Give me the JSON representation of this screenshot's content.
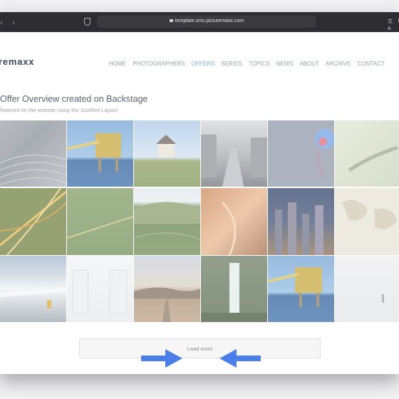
{
  "browser": {
    "back_glyph": "‹",
    "forward_glyph": "›",
    "url": "template.cms.picturemaxx.com",
    "translate_glyph": "文A",
    "reload_glyph": "↻"
  },
  "site": {
    "logo": "remaxx",
    "nav": [
      "HOME",
      "PHOTOGRAPHERS",
      "OFFERS",
      "SERIES",
      "TOPICS",
      "NEWS",
      "ABOUT",
      "ARCHIVE",
      "CONTACT"
    ],
    "active_nav": "OFFERS"
  },
  "page": {
    "title": "Offer Overview created on Backstage",
    "subtitle_prefix": "featured on the website using the ",
    "subtitle_emphasis": "Justified Layout"
  },
  "gallery": {
    "images": [
      {
        "subject": "abstract-lines"
      },
      {
        "subject": "oil-platform"
      },
      {
        "subject": "farmhouse-field"
      },
      {
        "subject": "city-street"
      },
      {
        "subject": "jellyfish"
      },
      {
        "subject": "crocodile"
      },
      {
        "subject": "light-trails"
      },
      {
        "subject": "green-field-line"
      },
      {
        "subject": "green-hills"
      },
      {
        "subject": "orange-abstract"
      },
      {
        "subject": "city-night-skyline"
      },
      {
        "subject": "world-map"
      },
      {
        "subject": "icy-waterfall-hiker"
      },
      {
        "subject": "server-room"
      },
      {
        "subject": "desert-road"
      },
      {
        "subject": "waterfall-cliff"
      },
      {
        "subject": "oil-platform-2"
      },
      {
        "subject": "foggy-beach-surfer"
      }
    ]
  },
  "actions": {
    "load_more_label": "Load more",
    "annotation_arrow_color": "#4a7ee8"
  }
}
